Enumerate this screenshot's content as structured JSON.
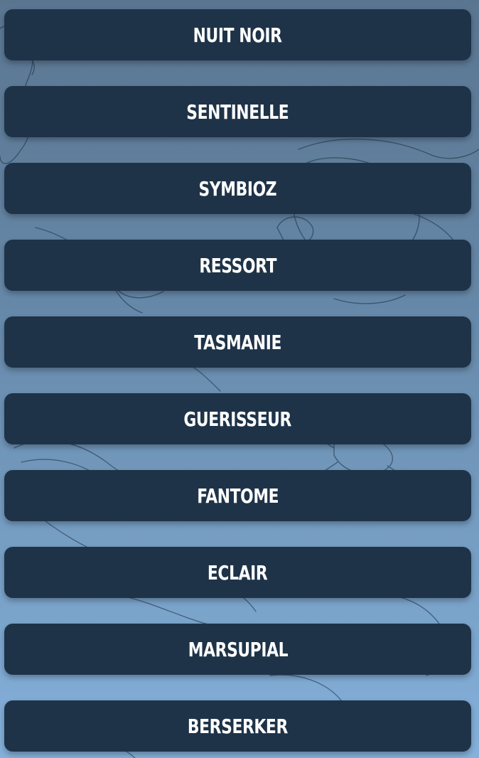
{
  "colors": {
    "button_bg": "#1e3348",
    "button_text": "#ffffff",
    "background_top": "#5a7590",
    "background_bottom": "#84b0da"
  },
  "menu": {
    "items": [
      {
        "label": "NUIT NOIR"
      },
      {
        "label": "SENTINELLE"
      },
      {
        "label": "SYMBIOZ"
      },
      {
        "label": "RESSORT"
      },
      {
        "label": "TASMANIE"
      },
      {
        "label": "GUERISSEUR"
      },
      {
        "label": "FANTOME"
      },
      {
        "label": "ECLAIR"
      },
      {
        "label": "MARSUPIAL"
      },
      {
        "label": "BERSERKER"
      }
    ]
  }
}
